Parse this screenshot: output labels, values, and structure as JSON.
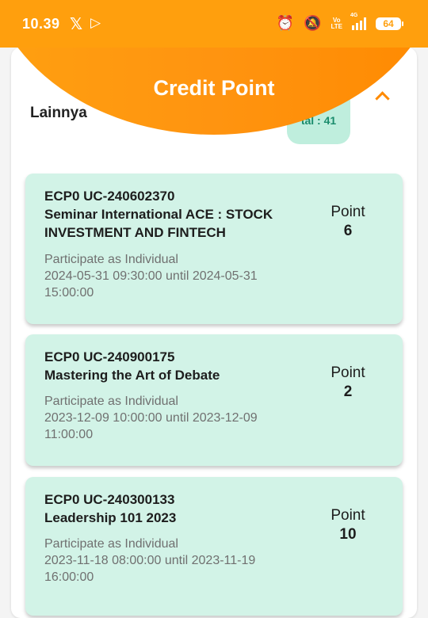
{
  "status_bar": {
    "time": "10.39",
    "x_icon": "x-icon",
    "play_icon": "play-outline-icon",
    "volte": [
      "Vo",
      "LTE"
    ],
    "network": "4G",
    "battery": "64"
  },
  "header": {
    "title": "Credit Point",
    "accent_color": "#ff9410"
  },
  "section": {
    "title": "Lainnya",
    "total_label": "tal : 41"
  },
  "colors": {
    "card_bg": "#d2f3e7",
    "badge_bg": "#bfeedd",
    "badge_text": "#1a8c6c"
  },
  "cards": [
    {
      "code": "ECP0 UC-240602370",
      "name": "Seminar International ACE : STOCK INVESTMENT AND FINTECH",
      "role": "Participate as Individual",
      "time": "2024-05-31 09:30:00 until 2024-05-31 15:00:00",
      "point_label": "Point",
      "point_value": "6"
    },
    {
      "code": "ECP0 UC-240900175",
      "name": "Mastering the Art of Debate",
      "role": "Participate as Individual",
      "time": "2023-12-09 10:00:00 until 2023-12-09 11:00:00",
      "point_label": "Point",
      "point_value": "2"
    },
    {
      "code": "ECP0 UC-240300133",
      "name": "Leadership 101 2023",
      "role": "Participate as Individual",
      "time": "2023-11-18 08:00:00 until 2023-11-19 16:00:00",
      "point_label": "Point",
      "point_value": "10"
    }
  ]
}
